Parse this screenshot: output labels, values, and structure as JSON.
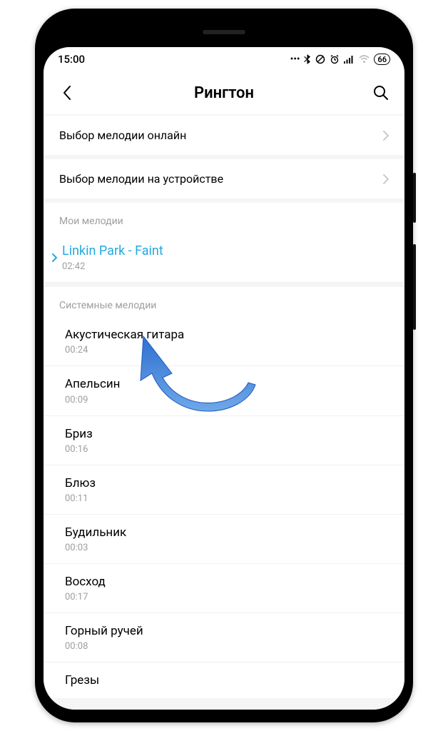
{
  "status": {
    "time": "15:00",
    "battery": "66"
  },
  "header": {
    "title": "Рингтон"
  },
  "nav": {
    "online": "Выбор мелодии онлайн",
    "device": "Выбор мелодии на устройстве"
  },
  "sections": {
    "my": "Мои мелодии",
    "system": "Системные мелодии"
  },
  "my_melodies": [
    {
      "title": "Linkin Park - Faint",
      "duration": "02:42"
    }
  ],
  "system_melodies": [
    {
      "title": "Акустическая гитара",
      "duration": "00:24"
    },
    {
      "title": "Апельсин",
      "duration": "00:09"
    },
    {
      "title": "Бриз",
      "duration": "00:16"
    },
    {
      "title": "Блюз",
      "duration": "00:11"
    },
    {
      "title": "Будильник",
      "duration": "00:03"
    },
    {
      "title": "Восход",
      "duration": "00:17"
    },
    {
      "title": "Горный ручей",
      "duration": "00:08"
    },
    {
      "title": "Грезы",
      "duration": ""
    }
  ],
  "colors": {
    "accent": "#24a8e0"
  }
}
